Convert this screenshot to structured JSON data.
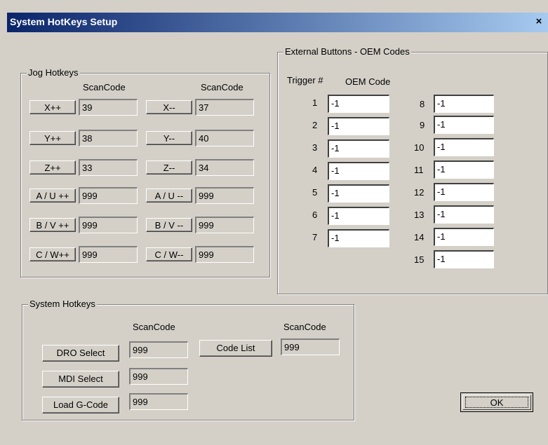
{
  "window": {
    "title": "System HotKeys Setup",
    "close_label": "×"
  },
  "jog": {
    "group_label": "Jog Hotkeys",
    "scancode_header": "ScanCode",
    "rows": [
      {
        "left": {
          "label": "X++",
          "value": "39"
        },
        "right": {
          "label": "X--",
          "value": "37"
        }
      },
      {
        "left": {
          "label": "Y++",
          "value": "38"
        },
        "right": {
          "label": "Y--",
          "value": "40"
        }
      },
      {
        "left": {
          "label": "Z++",
          "value": "33"
        },
        "right": {
          "label": "Z--",
          "value": "34"
        }
      },
      {
        "left": {
          "label": "A / U ++",
          "value": "999"
        },
        "right": {
          "label": "A / U --",
          "value": "999"
        }
      },
      {
        "left": {
          "label": "B / V ++",
          "value": "999"
        },
        "right": {
          "label": "B / V --",
          "value": "999"
        }
      },
      {
        "left": {
          "label": "C / W++",
          "value": "999"
        },
        "right": {
          "label": "C / W--",
          "value": "999"
        }
      }
    ]
  },
  "external": {
    "group_label": "External Buttons - OEM Codes",
    "trigger_header": "Trigger #",
    "oem_header": "OEM Code",
    "col1": [
      {
        "num": "1",
        "value": "-1"
      },
      {
        "num": "2",
        "value": "-1"
      },
      {
        "num": "3",
        "value": "-1"
      },
      {
        "num": "4",
        "value": "-1"
      },
      {
        "num": "5",
        "value": "-1"
      },
      {
        "num": "6",
        "value": "-1"
      },
      {
        "num": "7",
        "value": "-1"
      }
    ],
    "col2": [
      {
        "num": "8",
        "value": "-1"
      },
      {
        "num": "9",
        "value": "-1"
      },
      {
        "num": "10",
        "value": "-1"
      },
      {
        "num": "11",
        "value": "-1"
      },
      {
        "num": "12",
        "value": "-1"
      },
      {
        "num": "13",
        "value": "-1"
      },
      {
        "num": "14",
        "value": "-1"
      },
      {
        "num": "15",
        "value": "-1"
      }
    ]
  },
  "system": {
    "group_label": "System Hotkeys",
    "scancode_header": "ScanCode",
    "dro_label": "DRO Select",
    "dro_value": "999",
    "mdi_label": "MDI Select",
    "mdi_value": "999",
    "load_label": "Load G-Code",
    "load_value": "999",
    "codelist_label": "Code List",
    "codelist_value": "999"
  },
  "ok_label": "OK"
}
